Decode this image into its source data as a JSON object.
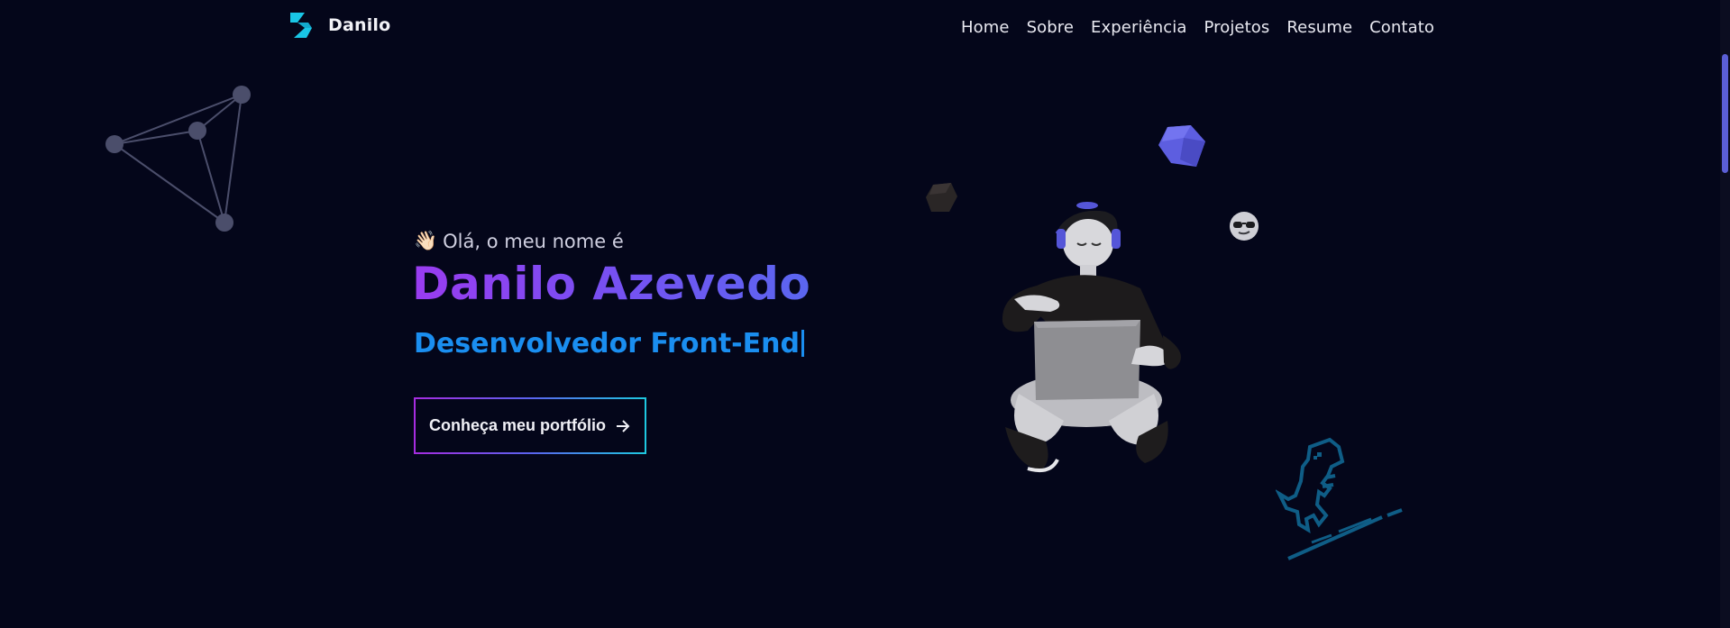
{
  "brand": {
    "name": "Danilo",
    "logo_icon": "bolt-logo-icon",
    "accent": "#19c6e6"
  },
  "nav": {
    "items": [
      {
        "label": "Home"
      },
      {
        "label": "Sobre"
      },
      {
        "label": "Experiência"
      },
      {
        "label": "Projetos"
      },
      {
        "label": "Resume"
      },
      {
        "label": "Contato"
      }
    ]
  },
  "hero": {
    "greeting_emoji": "👋🏻",
    "greeting": "Olá, o meu nome é",
    "name": "Danilo Azevedo",
    "role": "Desenvolvedor Front-End",
    "cta_label": "Conheça meu portfólio",
    "cta_icon": "arrow-right-icon"
  },
  "colors": {
    "background": "#04061a",
    "name_gradient": [
      "#9a3cf0",
      "#5a66f0"
    ],
    "role": "#1a8ef0",
    "cta_border_gradient": [
      "#a62ce0",
      "#1ec8e0"
    ]
  },
  "decorations": [
    "network-graph-icon",
    "purple-cube-icon",
    "dark-cube-icon",
    "sunglasses-emoji-icon",
    "developer-3d-illustration",
    "pixel-dinosaur-icon"
  ]
}
